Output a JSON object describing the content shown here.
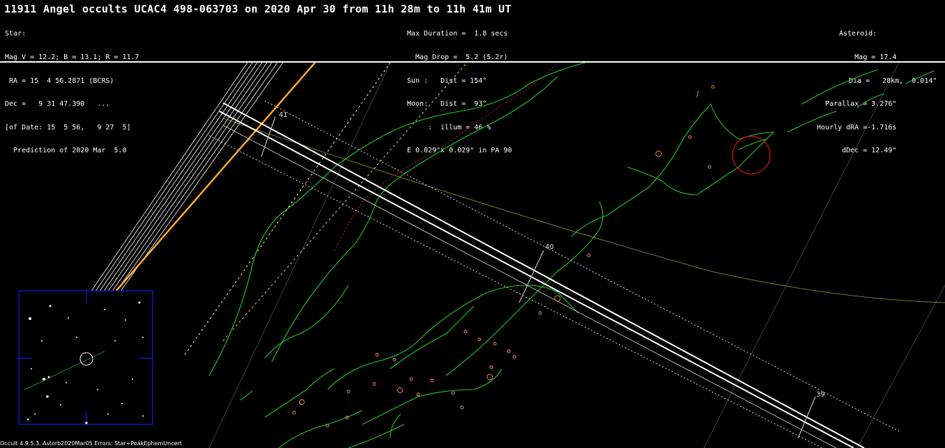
{
  "header": {
    "title": "11911 Angel occults UCAC4 498-063703 on 2020 Apr 30 from 11h 28m to 11h 41m UT",
    "star_lines": [
      "Star:",
      "Mag V = 12.2; B = 13.1; R = 11.7",
      " RA = 15  4 56.2871 (BCRS)",
      "Dec =   9 31 47.390   ...",
      "[of Date: 15  5 56,   9 27  5]",
      "  Prediction of 2020 Mar  5.0"
    ],
    "event_lines": [
      "Max Duration =  1.8 secs",
      "  Mag Drop =  5.2 (5.2r)",
      "Sun :   Dist = 154°",
      "Moon:   Dist =  93°",
      "     :  illum = 46 %",
      "E 0.029\"x 0.029\" in PA 90"
    ],
    "asteroid_lines": [
      "Asteroid:",
      "Mag = 17.4",
      "Dia =   28km,  0.014\"",
      "Parallax = 3.276\"",
      "Hourly dRA =-1.716s",
      "dDec = 12.49\""
    ]
  },
  "map": {
    "time_labels": [
      "41",
      "40",
      "39"
    ]
  },
  "colors": {
    "background": "#000000",
    "coastline": "#22cc22",
    "path": "#ffffff",
    "error_limits": "#dddddd",
    "sun_terminator": "#ffaa33",
    "border": "#cc2222",
    "cities": "#ff9944",
    "star_chart_frame": "#1414c8"
  },
  "footer": {
    "text": "Occult 4.9.5.3, Astorb2020Mar05  Errors: Star+PeakEphemUncert"
  }
}
